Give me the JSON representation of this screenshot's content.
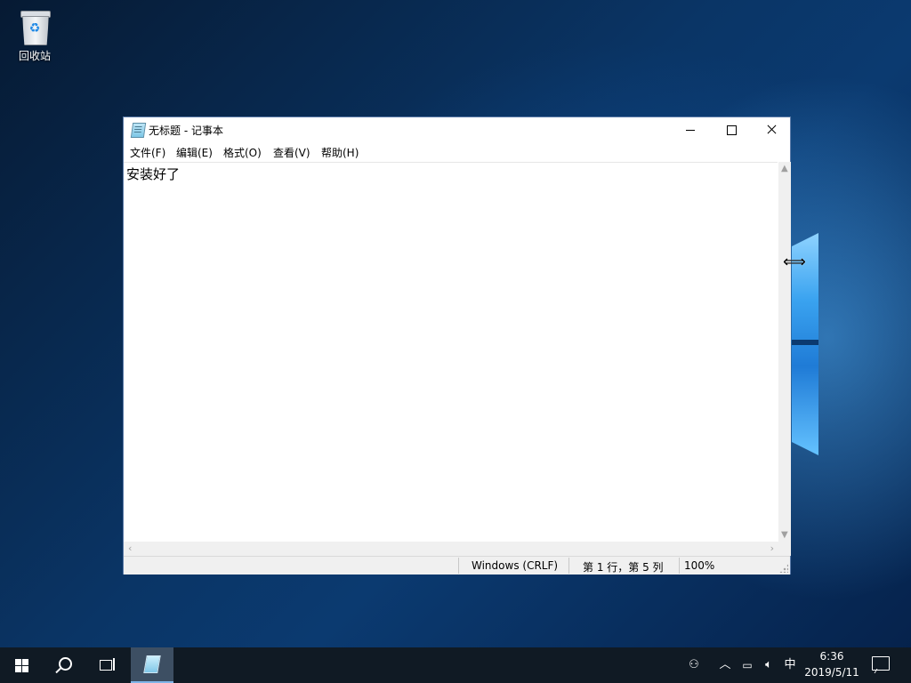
{
  "desktop": {
    "recycle_bin_label": "回收站"
  },
  "window": {
    "title": "无标题 - 记事本",
    "menu": [
      "文件(F)",
      "编辑(E)",
      "格式(O)",
      "查看(V)",
      "帮助(H)"
    ],
    "content": "安装好了",
    "status": {
      "line_ending": "Windows (CRLF)",
      "position": "第 1 行，第 5 列",
      "zoom": "100%"
    }
  },
  "taskbar": {
    "ime": "中",
    "time": "6:36",
    "date": "2019/5/11"
  }
}
